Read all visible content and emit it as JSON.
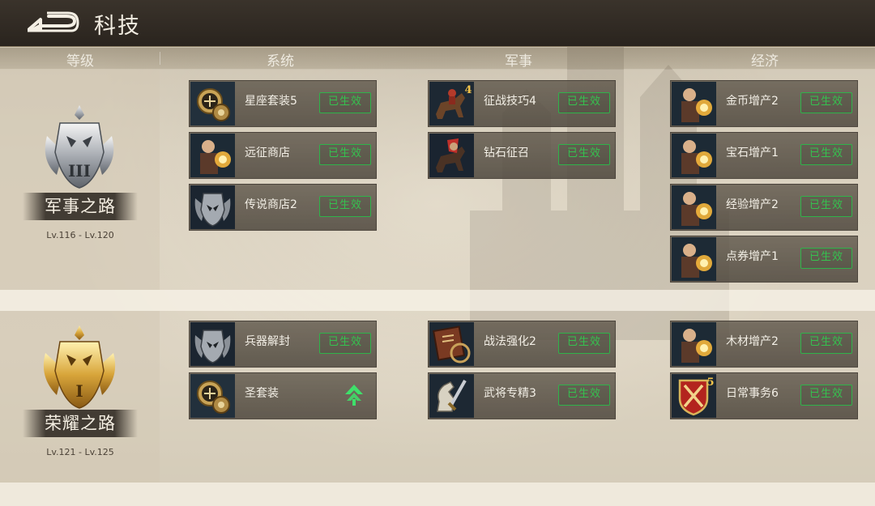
{
  "header": {
    "title": "科技"
  },
  "columns": [
    "等级",
    "系统",
    "军事",
    "经济"
  ],
  "tiers": [
    {
      "rank_name": "军事之路",
      "rank_numeral": "III",
      "level_range": "Lv.116 - Lv.120",
      "system": [
        {
          "name": "星座套装5",
          "status": "已生效",
          "icon": "constellation-medallion-icon"
        },
        {
          "name": "远征商店",
          "status": "已生效",
          "icon": "merchant-portrait-icon"
        },
        {
          "name": "传说商店2",
          "status": "已生效",
          "icon": "helmet-crest-icon"
        }
      ],
      "military": [
        {
          "name": "征战技巧4",
          "status": "已生效",
          "icon": "cavalry-icon",
          "icon_number": "4"
        },
        {
          "name": "钻石征召",
          "status": "已生效",
          "icon": "cavalry-red-icon"
        }
      ],
      "economy": [
        {
          "name": "金币增产2",
          "status": "已生效",
          "icon": "merchant-portrait-icon"
        },
        {
          "name": "宝石增产1",
          "status": "已生效",
          "icon": "merchant-portrait-icon"
        },
        {
          "name": "经验增产2",
          "status": "已生效",
          "icon": "merchant-portrait-icon"
        },
        {
          "name": "点券增产1",
          "status": "已生效",
          "icon": "merchant-portrait-icon"
        }
      ]
    },
    {
      "rank_name": "荣耀之路",
      "rank_numeral": "I",
      "level_range": "Lv.121 - Lv.125",
      "system": [
        {
          "name": "兵器解封",
          "status": "已生效",
          "icon": "helmet-crest-icon"
        },
        {
          "name": "圣套装",
          "status": "",
          "icon": "constellation-medallion-icon",
          "upgradable": true
        }
      ],
      "military": [
        {
          "name": "战法强化2",
          "status": "已生效",
          "icon": "tactics-book-icon"
        },
        {
          "name": "武将专精3",
          "status": "已生效",
          "icon": "knight-sword-icon"
        }
      ],
      "economy": [
        {
          "name": "木材增产2",
          "status": "已生效",
          "icon": "merchant-portrait-icon"
        },
        {
          "name": "日常事务6",
          "status": "已生效",
          "icon": "shield-sword-icon",
          "icon_number": "5"
        }
      ]
    }
  ],
  "colors": {
    "active_badge": "#35c24f",
    "header_bg": "#2a241e",
    "card_bg": "#5a5246",
    "upgrade_arrow": "#3ee06a"
  }
}
